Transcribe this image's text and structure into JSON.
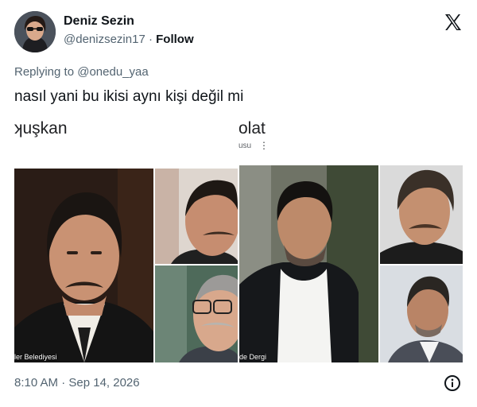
{
  "tweet": {
    "display_name": "Deniz Sezin",
    "handle": "@denizsezin17",
    "separator": "·",
    "follow_label": "Follow",
    "replying_to_prefix": "Replying to",
    "replying_to_handle": "@onedu_yaa",
    "text": "nasıl yani bu ikisi aynı kişi değil mi",
    "timestamp": "8:10 AM · Sep 14, 2026"
  },
  "embedded": {
    "left_title_fragment": "ʞuşkan",
    "right_title_fragment": "olat",
    "right_subtitle_fragment": "usu",
    "left_caption": "ler Belediyesi",
    "right_caption": "de Dergi"
  },
  "icons": {
    "x_logo": "x-logo-icon",
    "info": "info-icon",
    "more": "more-vertical-icon"
  }
}
